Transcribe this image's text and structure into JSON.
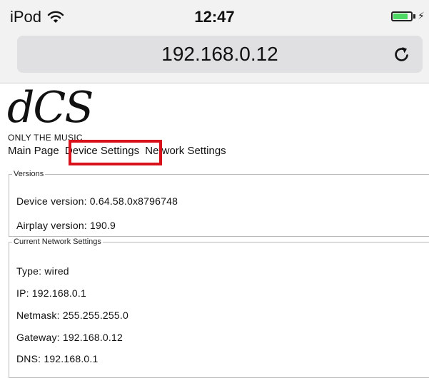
{
  "status": {
    "carrier": "iPod",
    "time": "12:47",
    "battery_level": 0.85,
    "battery_color": "#4cd964",
    "icons": [
      "wifi-icon",
      "battery-icon",
      "charging-bolt-icon"
    ]
  },
  "browser": {
    "url": "192.168.0.12",
    "reload_icon": "reload-icon"
  },
  "page": {
    "logo_text": "dCS",
    "tagline": "ONLY THE MUSIC",
    "nav": {
      "main_page": "Main Page",
      "device_settings": "Device Settings",
      "network_settings": "Network Settings"
    },
    "highlight_color": "#d8111b",
    "versions": {
      "legend": "Versions",
      "device_version": "Device version: 0.64.58.0x8796748",
      "airplay_version": "Airplay version: 190.9"
    },
    "network": {
      "legend": "Current Network Settings",
      "type": "Type: wired",
      "ip": "IP: 192.168.0.1",
      "netmask": "Netmask: 255.255.255.0",
      "gateway": "Gateway: 192.168.0.12",
      "dns": "DNS: 192.168.0.1"
    }
  }
}
